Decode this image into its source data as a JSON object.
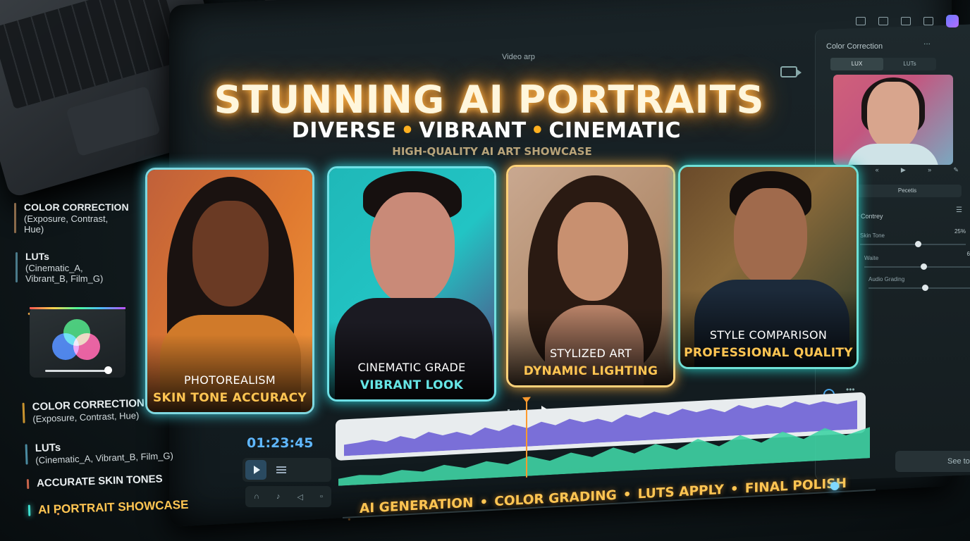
{
  "title": "STUNNING AI PORTRAITS",
  "subtitle": [
    "DIVERSE",
    "VIBRANT",
    "CINEMATIC"
  ],
  "subtitle_dot": "•",
  "tagline": "HIGH-QUALITY AI ART SHOWCASE",
  "editor": {
    "window_label": "Video arp",
    "timecode": "01:23:45"
  },
  "right_panel": {
    "title": "Color Correction",
    "more": "...",
    "tabs": [
      {
        "label": "LUX",
        "active": true
      },
      {
        "label": "LUTs",
        "active": false
      }
    ],
    "presets_button": "Pecetis",
    "section": "Contrey",
    "sliders": [
      {
        "label": "Skin Tone",
        "value_text": "25%",
        "level": 0.55
      },
      {
        "label": "Waite",
        "value_text": "6",
        "level": 0.6
      },
      {
        "label": "Audio Grading",
        "value_text": "",
        "level": 0.6
      }
    ],
    "see_button": "See to"
  },
  "left_top": [
    {
      "head": "COLOR CORRECTION",
      "sub": "(Exposure, Contrast, Hue)",
      "bar_color": "#8a6a4a"
    },
    {
      "head": "LUTs",
      "sub": "(Cinematic_A, Vibrant_B, Film_G)",
      "bar_color": "#4a7a8a"
    }
  ],
  "left_bottom": [
    {
      "head": "COLOR CORRECTION",
      "sub": "(Exposure, Contrast, Hue)",
      "bar_color": "#c8922e"
    },
    {
      "head": "LUTs",
      "sub": "(Cinematic_A, Vibrant_B, Film_G)",
      "bar_color": "#4a8aa0"
    },
    {
      "head": "ACCURATE SKIN TONES",
      "sub": "",
      "bar_color": "#c8644a"
    },
    {
      "head": "AI PORTRAIT SHOWCASE",
      "sub": "",
      "bar_color": "#3ee0d0"
    }
  ],
  "cards": [
    {
      "line1": "PHOTOREALISM",
      "line2": "SKIN TONE ACCURACY",
      "border": "#7fd8e0",
      "accent": "#ffc552"
    },
    {
      "line1": "CINEMATIC GRADE",
      "line2": "VIBRANT LOOK",
      "border": "#6fe0e6",
      "accent": "#66e6e6"
    },
    {
      "line1": "STYLIZED ART",
      "line2": "DYNAMIC LIGHTING",
      "border": "#ffd27a",
      "accent": "#ffc552"
    },
    {
      "line1": "STYLE COMPARISON",
      "line2": "PROFESSIONAL QUALITY",
      "border": "#6fe0d6",
      "accent": "#ffc552"
    }
  ],
  "pipeline": [
    "AI GENERATION",
    "COLOR GRADING",
    "LUTS APPLY",
    "FINAL POLISH"
  ],
  "colors": {
    "title_glow": "#ffb547",
    "accent_orange": "#ff9a2e",
    "timecode_blue": "#5fb7ff",
    "audio_purple": "#7a6fd8",
    "audio_green": "#4fe0b0"
  },
  "icons": [
    "camera-icon",
    "prev-icon",
    "play-icon",
    "list-icon",
    "headphones-icon",
    "mic-icon",
    "speaker-icon",
    "loop-icon"
  ]
}
